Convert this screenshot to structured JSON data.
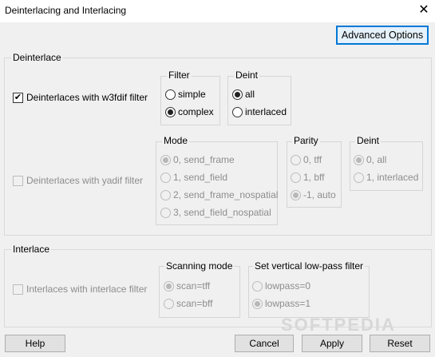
{
  "window": {
    "title": "Deinterlacing and Interlacing"
  },
  "toolbar": {
    "advanced_options": "Advanced Options"
  },
  "deinterlace": {
    "legend": "Deinterlace",
    "w3fdif": {
      "label": "Deinterlaces with w3fdif filter",
      "filter": {
        "legend": "Filter",
        "options": [
          "simple",
          "complex"
        ],
        "selected": "complex"
      },
      "deint": {
        "legend": "Deint",
        "options": [
          "all",
          "interlaced"
        ],
        "selected": "all"
      }
    },
    "yadif": {
      "label": "Deinterlaces with yadif filter",
      "mode": {
        "legend": "Mode",
        "options": [
          "0, send_frame",
          "1, send_field",
          "2, send_frame_nospatial",
          "3, send_field_nospatial"
        ],
        "selected": "0, send_frame"
      },
      "parity": {
        "legend": "Parity",
        "options": [
          "0, tff",
          "1, bff",
          "-1, auto"
        ],
        "selected": "-1, auto"
      },
      "deint": {
        "legend": "Deint",
        "options": [
          "0, all",
          "1, interlaced"
        ],
        "selected": "0, all"
      }
    }
  },
  "interlace": {
    "legend": "Interlace",
    "filter_label": "Interlaces with interlace filter",
    "scanning": {
      "legend": "Scanning mode",
      "options": [
        "scan=tff",
        "scan=bff"
      ],
      "selected": "scan=tff"
    },
    "lowpass": {
      "legend": "Set vertical low-pass filter",
      "options": [
        "lowpass=0",
        "lowpass=1"
      ],
      "selected": "lowpass=1"
    }
  },
  "footer": {
    "help": "Help",
    "cancel": "Cancel",
    "apply": "Apply",
    "reset": "Reset"
  },
  "watermark": "SOFTPEDIA"
}
